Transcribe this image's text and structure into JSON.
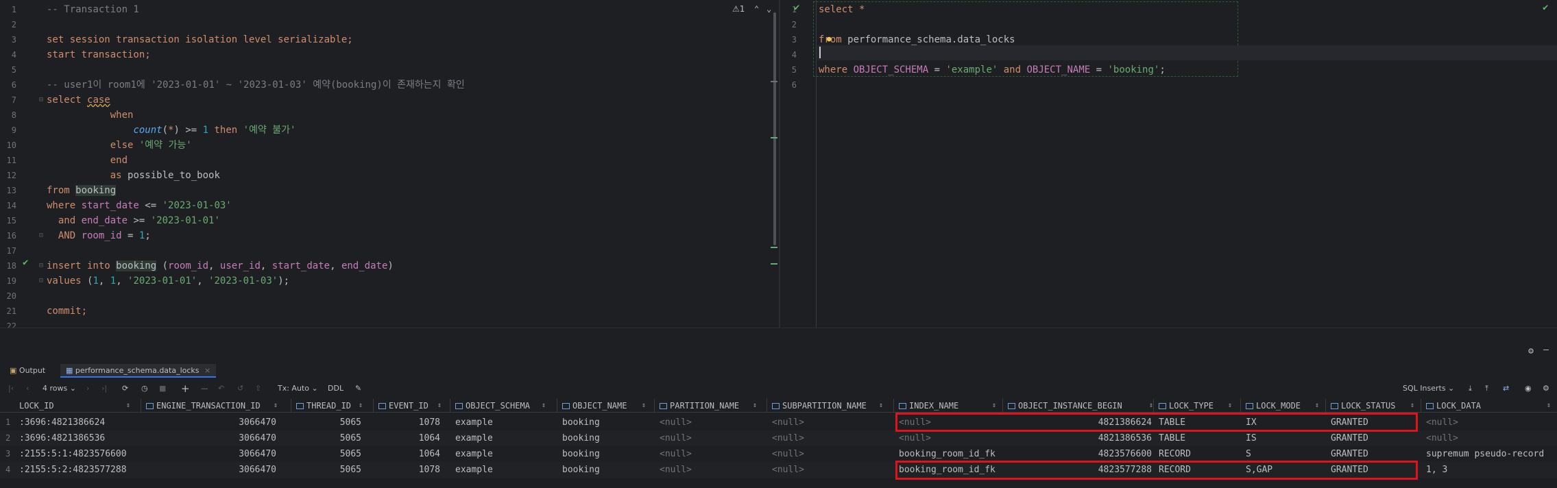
{
  "editor_left": {
    "inspection_count": "1",
    "lines": [
      {
        "n": "1",
        "tokens": [
          {
            "t": "-- Transaction 1",
            "c": "com"
          }
        ]
      },
      {
        "n": "2",
        "tokens": []
      },
      {
        "n": "3",
        "tokens": [
          {
            "t": "set session transaction isolation level serializable;",
            "c": "kw"
          }
        ]
      },
      {
        "n": "4",
        "tokens": [
          {
            "t": "start transaction;",
            "c": "kw"
          }
        ]
      },
      {
        "n": "5",
        "tokens": []
      },
      {
        "n": "6",
        "tokens": [
          {
            "t": "-- user1이 room1에 '2023-01-01' ~ '2023-01-03' 예약(booking)이 존재하는지 확인",
            "c": "com"
          }
        ]
      },
      {
        "n": "7",
        "tokens": [
          {
            "t": "select ",
            "c": "kw"
          },
          {
            "t": "case",
            "c": "kw under"
          }
        ]
      },
      {
        "n": "8",
        "tokens": [
          {
            "t": "           when",
            "c": "kw"
          }
        ]
      },
      {
        "n": "9",
        "tokens": [
          {
            "t": "               ",
            "c": "ident"
          },
          {
            "t": "count",
            "c": "fn"
          },
          {
            "t": "(",
            "c": "ident"
          },
          {
            "t": "*",
            "c": "kw"
          },
          {
            "t": ") >= ",
            "c": "ident"
          },
          {
            "t": "1",
            "c": "num"
          },
          {
            "t": " then ",
            "c": "kw"
          },
          {
            "t": "'예약 불가'",
            "c": "str"
          }
        ]
      },
      {
        "n": "10",
        "tokens": [
          {
            "t": "           else ",
            "c": "kw"
          },
          {
            "t": "'예약 가능'",
            "c": "str"
          }
        ]
      },
      {
        "n": "11",
        "tokens": [
          {
            "t": "           end",
            "c": "kw"
          }
        ]
      },
      {
        "n": "12",
        "tokens": [
          {
            "t": "           as ",
            "c": "kw"
          },
          {
            "t": "possible_to_book",
            "c": "ident"
          }
        ]
      },
      {
        "n": "13",
        "tokens": [
          {
            "t": "from ",
            "c": "kw"
          },
          {
            "t": "booking",
            "c": "tbl"
          }
        ]
      },
      {
        "n": "14",
        "tokens": [
          {
            "t": "where ",
            "c": "kw"
          },
          {
            "t": "start_date",
            "c": "col"
          },
          {
            "t": " <= ",
            "c": "ident"
          },
          {
            "t": "'2023-01-03'",
            "c": "str"
          }
        ]
      },
      {
        "n": "15",
        "tokens": [
          {
            "t": "  and ",
            "c": "kw"
          },
          {
            "t": "end_date",
            "c": "col"
          },
          {
            "t": " >= ",
            "c": "ident"
          },
          {
            "t": "'2023-01-01'",
            "c": "str"
          }
        ]
      },
      {
        "n": "16",
        "tokens": [
          {
            "t": "  AND ",
            "c": "kw"
          },
          {
            "t": "room_id",
            "c": "col"
          },
          {
            "t": " = ",
            "c": "ident"
          },
          {
            "t": "1",
            "c": "num"
          },
          {
            "t": ";",
            "c": "ident"
          }
        ]
      },
      {
        "n": "17",
        "tokens": []
      },
      {
        "n": "18",
        "tokens": [
          {
            "t": "insert into ",
            "c": "kw"
          },
          {
            "t": "booking",
            "c": "tbl"
          },
          {
            "t": " (",
            "c": "ident"
          },
          {
            "t": "room_id",
            "c": "col"
          },
          {
            "t": ", ",
            "c": "ident"
          },
          {
            "t": "user_id",
            "c": "col"
          },
          {
            "t": ", ",
            "c": "ident"
          },
          {
            "t": "start_date",
            "c": "col"
          },
          {
            "t": ", ",
            "c": "ident"
          },
          {
            "t": "end_date",
            "c": "col"
          },
          {
            "t": ")",
            "c": "ident"
          }
        ]
      },
      {
        "n": "19",
        "tokens": [
          {
            "t": "values ",
            "c": "kw"
          },
          {
            "t": "(",
            "c": "ident"
          },
          {
            "t": "1",
            "c": "num"
          },
          {
            "t": ", ",
            "c": "ident"
          },
          {
            "t": "1",
            "c": "num"
          },
          {
            "t": ", ",
            "c": "ident"
          },
          {
            "t": "'2023-01-01'",
            "c": "str"
          },
          {
            "t": ", ",
            "c": "ident"
          },
          {
            "t": "'2023-01-03'",
            "c": "str"
          },
          {
            "t": ");",
            "c": "ident"
          }
        ]
      },
      {
        "n": "20",
        "tokens": []
      },
      {
        "n": "21",
        "tokens": [
          {
            "t": "commit;",
            "c": "kw"
          }
        ]
      },
      {
        "n": "22",
        "tokens": []
      }
    ]
  },
  "editor_right": {
    "lines": [
      {
        "n": "1",
        "tokens": [
          {
            "t": "select ",
            "c": "kw"
          },
          {
            "t": "*",
            "c": "kw"
          }
        ]
      },
      {
        "n": "2",
        "tokens": []
      },
      {
        "n": "3",
        "tokens": [
          {
            "t": "fr",
            "c": "kw"
          },
          {
            "t": "om ",
            "c": "kw"
          },
          {
            "t": "performance_schema.data_locks",
            "c": "ident"
          }
        ]
      },
      {
        "n": "4",
        "tokens": []
      },
      {
        "n": "5",
        "tokens": [
          {
            "t": "where ",
            "c": "kw"
          },
          {
            "t": "OBJECT_SCHEMA",
            "c": "col"
          },
          {
            "t": " = ",
            "c": "ident"
          },
          {
            "t": "'example'",
            "c": "str"
          },
          {
            "t": " and ",
            "c": "kw"
          },
          {
            "t": "OBJECT_NAME",
            "c": "col"
          },
          {
            "t": " = ",
            "c": "ident"
          },
          {
            "t": "'booking'",
            "c": "str"
          },
          {
            "t": ";",
            "c": "ident"
          }
        ]
      },
      {
        "n": "6",
        "tokens": []
      }
    ]
  },
  "results": {
    "tabs": [
      {
        "label": "Output",
        "icon": "output-icon"
      },
      {
        "label": "performance_schema.data_locks",
        "icon": "table-icon",
        "closable": true
      }
    ],
    "toolbar": {
      "rows_label": "4 rows",
      "tx_label": "Tx: Auto",
      "ddl_label": "DDL",
      "export_label": "SQL Inserts"
    },
    "columns": [
      {
        "label": "LOCK_ID",
        "key": "lock_id"
      },
      {
        "label": "ENGINE_TRANSACTION_ID",
        "key": "engine_tx"
      },
      {
        "label": "THREAD_ID",
        "key": "thread"
      },
      {
        "label": "EVENT_ID",
        "key": "event"
      },
      {
        "label": "OBJECT_SCHEMA",
        "key": "schema"
      },
      {
        "label": "OBJECT_NAME",
        "key": "name"
      },
      {
        "label": "PARTITION_NAME",
        "key": "partition"
      },
      {
        "label": "SUBPARTITION_NAME",
        "key": "subpartition"
      },
      {
        "label": "INDEX_NAME",
        "key": "index"
      },
      {
        "label": "OBJECT_INSTANCE_BEGIN",
        "key": "obj_inst"
      },
      {
        "label": "LOCK_TYPE",
        "key": "lock_type"
      },
      {
        "label": "LOCK_MODE",
        "key": "lock_mode"
      },
      {
        "label": "LOCK_STATUS",
        "key": "lock_status"
      },
      {
        "label": "LOCK_DATA",
        "key": "lock_data"
      }
    ],
    "rows": [
      {
        "num": "1",
        "lock_id": ":3696:4821386624",
        "engine_tx": "3066470",
        "thread": "5065",
        "event": "1078",
        "schema": "example",
        "name": "booking",
        "partition": "<null>",
        "subpartition": "<null>",
        "index": "<null>",
        "obj_inst": "4821386624",
        "lock_type": "TABLE",
        "lock_mode": "IX",
        "lock_status": "GRANTED",
        "lock_data": "<null>"
      },
      {
        "num": "2",
        "lock_id": ":3696:4821386536",
        "engine_tx": "3066470",
        "thread": "5065",
        "event": "1064",
        "schema": "example",
        "name": "booking",
        "partition": "<null>",
        "subpartition": "<null>",
        "index": "<null>",
        "obj_inst": "4821386536",
        "lock_type": "TABLE",
        "lock_mode": "IS",
        "lock_status": "GRANTED",
        "lock_data": "<null>"
      },
      {
        "num": "3",
        "lock_id": ":2155:5:1:4823576600",
        "engine_tx": "3066470",
        "thread": "5065",
        "event": "1064",
        "schema": "example",
        "name": "booking",
        "partition": "<null>",
        "subpartition": "<null>",
        "index": "booking_room_id_fk",
        "obj_inst": "4823576600",
        "lock_type": "RECORD",
        "lock_mode": "S",
        "lock_status": "GRANTED",
        "lock_data": "supremum pseudo-record"
      },
      {
        "num": "4",
        "lock_id": ":2155:5:2:4823577288",
        "engine_tx": "3066470",
        "thread": "5065",
        "event": "1078",
        "schema": "example",
        "name": "booking",
        "partition": "<null>",
        "subpartition": "<null>",
        "index": "booking_room_id_fk",
        "obj_inst": "4823577288",
        "lock_type": "RECORD",
        "lock_mode": "S,GAP",
        "lock_status": "GRANTED",
        "lock_data": "1, 3"
      }
    ]
  },
  "colors": {
    "highlight_box": "#e0121c",
    "keyword": "#cf8e6d",
    "string": "#6aab73",
    "column": "#c77dbb",
    "comment": "#7a7e85"
  }
}
